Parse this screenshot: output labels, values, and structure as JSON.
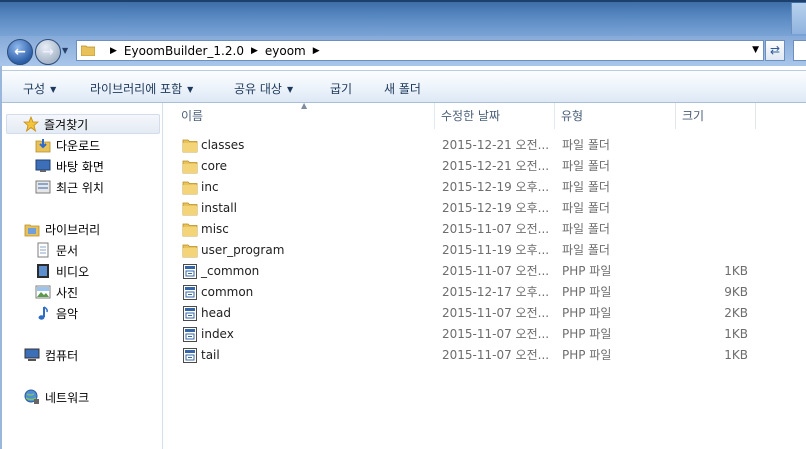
{
  "address": {
    "crumbs": [
      "EyoomBuilder_1.2.0",
      "eyoom"
    ]
  },
  "toolbar": {
    "organize": "구성",
    "include_library": "라이브러리에 포함",
    "share_with": "공유 대상",
    "burn": "굽기",
    "new_folder": "새 폴더"
  },
  "nav": {
    "favorites": "즐겨찾기",
    "downloads": "다운로드",
    "desktop": "바탕 화면",
    "recent": "최근 위치",
    "libraries": "라이브러리",
    "documents": "문서",
    "videos": "비디오",
    "pictures": "사진",
    "music": "음악",
    "computer": "컴퓨터",
    "network": "네트워크"
  },
  "columns": {
    "name": "이름",
    "date": "수정한 날짜",
    "type": "유형",
    "size": "크기"
  },
  "files": [
    {
      "name": "classes",
      "date": "2015-12-21 오전...",
      "type": "파일 폴더",
      "size": "",
      "kind": "folder"
    },
    {
      "name": "core",
      "date": "2015-12-21 오전...",
      "type": "파일 폴더",
      "size": "",
      "kind": "folder"
    },
    {
      "name": "inc",
      "date": "2015-12-19 오후...",
      "type": "파일 폴더",
      "size": "",
      "kind": "folder"
    },
    {
      "name": "install",
      "date": "2015-12-19 오후...",
      "type": "파일 폴더",
      "size": "",
      "kind": "folder"
    },
    {
      "name": "misc",
      "date": "2015-11-07 오전...",
      "type": "파일 폴더",
      "size": "",
      "kind": "folder"
    },
    {
      "name": "user_program",
      "date": "2015-11-19 오후...",
      "type": "파일 폴더",
      "size": "",
      "kind": "folder"
    },
    {
      "name": "_common",
      "date": "2015-11-07 오전...",
      "type": "PHP 파일",
      "size": "1KB",
      "kind": "php"
    },
    {
      "name": "common",
      "date": "2015-12-17 오후...",
      "type": "PHP 파일",
      "size": "9KB",
      "kind": "php"
    },
    {
      "name": "head",
      "date": "2015-11-07 오전...",
      "type": "PHP 파일",
      "size": "2KB",
      "kind": "php"
    },
    {
      "name": "index",
      "date": "2015-11-07 오전...",
      "type": "PHP 파일",
      "size": "1KB",
      "kind": "php"
    },
    {
      "name": "tail",
      "date": "2015-11-07 오전...",
      "type": "PHP 파일",
      "size": "1KB",
      "kind": "php"
    }
  ]
}
